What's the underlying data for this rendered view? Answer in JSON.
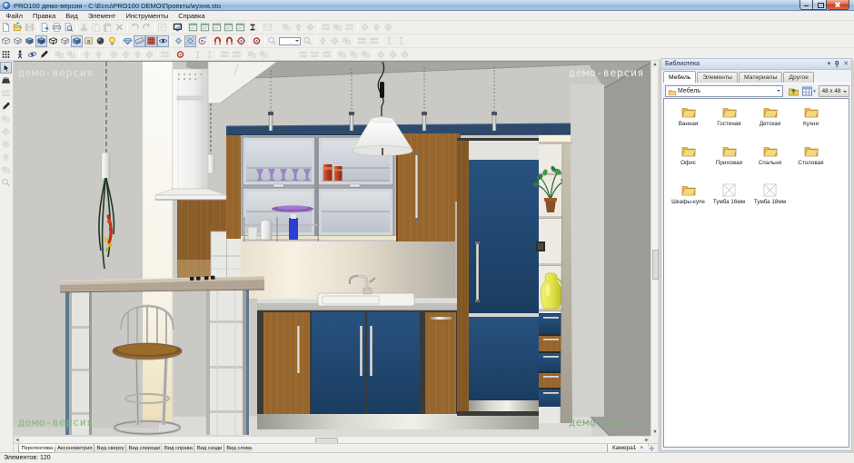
{
  "window": {
    "title": "PRO100 демо-версия - C:\\Ecru\\PRO100 DEMO\\Проекты\\кухня.sto",
    "controls": [
      {
        "name": "minimize"
      },
      {
        "name": "maximize"
      },
      {
        "name": "close"
      }
    ]
  },
  "menu": {
    "items": [
      "Файл",
      "Правка",
      "Вид",
      "Элемент",
      "Инструменты",
      "Справка"
    ]
  },
  "toolbars": {
    "row1": [
      {
        "name": "new-file",
        "icon": "page"
      },
      {
        "name": "open-file",
        "icon": "open"
      },
      {
        "name": "save-file",
        "icon": "save",
        "disabled": true
      },
      {
        "sep": true
      },
      {
        "name": "export",
        "icon": "export"
      },
      {
        "name": "print",
        "icon": "print"
      },
      {
        "name": "print-preview",
        "icon": "preview"
      },
      {
        "sep": true
      },
      {
        "name": "cut",
        "icon": "cut",
        "disabled": true
      },
      {
        "name": "copy",
        "icon": "copy",
        "disabled": true
      },
      {
        "name": "paste",
        "icon": "paste",
        "disabled": true
      },
      {
        "name": "delete",
        "icon": "del",
        "disabled": true
      },
      {
        "sep": true
      },
      {
        "name": "undo",
        "icon": "undo",
        "disabled": true
      },
      {
        "name": "redo",
        "icon": "redo",
        "disabled": true
      },
      {
        "sep": true
      },
      {
        "name": "properties",
        "icon": "props",
        "disabled": true
      },
      {
        "sep": true
      },
      {
        "name": "projection",
        "icon": "screen"
      },
      {
        "sep": true
      },
      {
        "name": "view-report",
        "icon": "win"
      },
      {
        "name": "view-pricelist",
        "icon": "win"
      },
      {
        "name": "view-cutlist",
        "icon": "win"
      },
      {
        "name": "view-elements",
        "icon": "win"
      },
      {
        "name": "view-materials",
        "icon": "win"
      },
      {
        "name": "price-calc",
        "icon": "sigma"
      },
      {
        "sep": true
      },
      {
        "name": "send-mail",
        "icon": "mail",
        "disabled": true
      },
      {
        "gap": 8
      },
      {
        "name": "arrange-1",
        "icon": "g1",
        "disabled": true
      },
      {
        "name": "arrange-2",
        "icon": "g2",
        "disabled": true
      },
      {
        "name": "arrange-3",
        "icon": "g3",
        "disabled": true
      },
      {
        "sep": true
      },
      {
        "name": "align-1",
        "icon": "g4",
        "disabled": true
      },
      {
        "name": "align-2",
        "icon": "g1",
        "disabled": true
      },
      {
        "name": "align-3",
        "icon": "g4",
        "disabled": true
      },
      {
        "sep": true
      },
      {
        "name": "space-1",
        "icon": "g3",
        "disabled": true
      },
      {
        "name": "space-2",
        "icon": "g2",
        "disabled": true
      },
      {
        "name": "space-3",
        "icon": "g3",
        "disabled": true
      }
    ],
    "row2": [
      {
        "name": "view-wireframe",
        "icon": "cube-wire"
      },
      {
        "name": "view-sketch",
        "icon": "cube-white"
      },
      {
        "name": "view-colors",
        "icon": "cube-blue"
      },
      {
        "name": "view-textures",
        "icon": "cube-tex",
        "pressed": true
      },
      {
        "name": "edges-all",
        "icon": "cube-edge"
      },
      {
        "name": "edges-white",
        "icon": "cube-white"
      },
      {
        "name": "edges-tex",
        "icon": "cube-blue",
        "pressed": true
      },
      {
        "name": "show-labels",
        "icon": "tex-a"
      },
      {
        "name": "antialias",
        "icon": "sphere"
      },
      {
        "name": "lighting",
        "icon": "bulb"
      },
      {
        "sep": true
      },
      {
        "name": "high-quality",
        "icon": "gem"
      },
      {
        "name": "show-dimensions",
        "icon": "ruler",
        "pressed": true
      },
      {
        "name": "show-grid",
        "icon": "grid-red",
        "pressed": true
      },
      {
        "name": "show-all",
        "icon": "eye",
        "pressed": true
      },
      {
        "sep": true
      },
      {
        "name": "snap-small",
        "icon": "diamond"
      },
      {
        "name": "snap-grid",
        "icon": "diamond-box",
        "pressed": true
      },
      {
        "name": "snap-rotate",
        "icon": "rotor"
      },
      {
        "sep": true
      },
      {
        "name": "magnet-1",
        "icon": "magnet"
      },
      {
        "name": "magnet-2",
        "icon": "magnet"
      },
      {
        "name": "magnet-3",
        "icon": "snap"
      },
      {
        "sep": true
      },
      {
        "name": "center-view",
        "icon": "target"
      },
      {
        "sep": true
      },
      {
        "name": "zoom-out",
        "icon": "mag",
        "disabled": true
      },
      {
        "combo": true,
        "name": "zoom-select"
      },
      {
        "name": "zoom-in",
        "icon": "mag",
        "disabled": true
      },
      {
        "sep": true
      },
      {
        "name": "move-1",
        "icon": "g2",
        "disabled": true
      },
      {
        "name": "move-2",
        "icon": "g3",
        "disabled": true
      },
      {
        "name": "move-3",
        "icon": "g1",
        "disabled": true
      },
      {
        "sep": true
      },
      {
        "name": "dim-1",
        "icon": "g4",
        "disabled": true
      },
      {
        "name": "dim-2",
        "icon": "g4",
        "disabled": true
      },
      {
        "sep": true
      },
      {
        "name": "text-1",
        "icon": "g5",
        "disabled": true
      },
      {
        "name": "text-2",
        "icon": "g5",
        "disabled": true
      }
    ],
    "row3": [
      {
        "name": "grid-snap",
        "icon": "dots"
      },
      {
        "gap": 3
      },
      {
        "name": "walk-mode",
        "icon": "man"
      },
      {
        "name": "orbit-mode",
        "icon": "orbit"
      },
      {
        "name": "draw-mode",
        "icon": "pen"
      },
      {
        "sep": true
      },
      {
        "name": "group",
        "icon": "g1",
        "disabled": true
      },
      {
        "name": "ungroup",
        "icon": "g1",
        "disabled": true
      },
      {
        "sep": true
      },
      {
        "name": "flip-h",
        "icon": "g2",
        "disabled": true
      },
      {
        "name": "flip-v",
        "icon": "g2",
        "disabled": true
      },
      {
        "sep": true
      },
      {
        "name": "rotate-left",
        "icon": "g3",
        "disabled": true
      },
      {
        "name": "move-el",
        "icon": "g3",
        "disabled": true
      },
      {
        "name": "lift-el",
        "icon": "g2",
        "disabled": true
      },
      {
        "name": "fit-el",
        "icon": "g3",
        "disabled": true
      },
      {
        "sep": true
      },
      {
        "name": "edit-shape",
        "icon": "g4",
        "disabled": true
      },
      {
        "sep": true
      },
      {
        "name": "center-element",
        "icon": "target"
      },
      {
        "gap": 6
      },
      {
        "name": "prev-el",
        "icon": "g5",
        "disabled": true
      },
      {
        "name": "next-el",
        "icon": "g5",
        "disabled": true
      },
      {
        "sep": true
      },
      {
        "name": "sum-1",
        "icon": "g4",
        "disabled": true
      },
      {
        "name": "sum-2",
        "icon": "g4",
        "disabled": true
      },
      {
        "sep": true
      },
      {
        "name": "rep-1",
        "icon": "g1",
        "disabled": true
      },
      {
        "name": "rep-2",
        "icon": "g1",
        "disabled": true
      },
      {
        "gap": 30
      },
      {
        "name": "lay-1",
        "icon": "g4",
        "disabled": true
      },
      {
        "name": "lay-2",
        "icon": "g4",
        "disabled": true
      },
      {
        "name": "lay-3",
        "icon": "g4",
        "disabled": true
      },
      {
        "sep": true
      },
      {
        "name": "dist-1",
        "icon": "g1",
        "disabled": true
      },
      {
        "name": "dist-2",
        "icon": "g1",
        "disabled": true
      },
      {
        "name": "dist-3",
        "icon": "g1",
        "disabled": true
      },
      {
        "sep": true
      },
      {
        "name": "rot-1",
        "icon": "g3",
        "disabled": true
      },
      {
        "name": "rot-2",
        "icon": "g3",
        "disabled": true
      },
      {
        "name": "rot-3",
        "icon": "g3",
        "disabled": true
      }
    ],
    "left": [
      {
        "name": "select-tool",
        "icon": "arrow",
        "pressed": true
      },
      {
        "name": "wall-tool",
        "icon": "comb"
      },
      {
        "name": "dimension-tool",
        "icon": "g4",
        "disabled": true
      },
      {
        "name": "pencil-tool",
        "icon": "pen"
      },
      {
        "name": "floor-tool",
        "icon": "g1",
        "disabled": true
      },
      {
        "name": "move-tool",
        "icon": "g3",
        "disabled": true
      },
      {
        "name": "rotate-tool",
        "icon": "g3",
        "disabled": true
      },
      {
        "name": "scale-tool",
        "icon": "g2",
        "disabled": true
      },
      {
        "name": "mirror-tool",
        "icon": "g1",
        "disabled": true
      },
      {
        "name": "zoom-tool",
        "icon": "mag",
        "disabled": true
      }
    ]
  },
  "viewport": {
    "watermark": "демо-версия"
  },
  "view_tabs": {
    "tabs": [
      {
        "label": "Перспектива",
        "active": true
      },
      {
        "label": "Аксонометрия"
      },
      {
        "label": "Вид сверху"
      },
      {
        "label": "Вид спереди"
      },
      {
        "label": "Вид справа"
      },
      {
        "label": "Вид сзади"
      },
      {
        "label": "Вид слева"
      }
    ],
    "camera_tab": "Камера1",
    "camera_close": "×"
  },
  "library": {
    "title": "Библиотека",
    "tabs": [
      {
        "label": "Мебель",
        "active": true
      },
      {
        "label": "Элементы"
      },
      {
        "label": "Материалы"
      },
      {
        "label": "Другое"
      }
    ],
    "path": "Мебель",
    "size_label": "48 x 48",
    "items": [
      {
        "label": "Ванная",
        "icon": "folder"
      },
      {
        "label": "Гостиная",
        "icon": "folder"
      },
      {
        "label": "Детская",
        "icon": "folder"
      },
      {
        "label": "Кухни",
        "icon": "folder"
      },
      {
        "label": "Офис",
        "icon": "folder"
      },
      {
        "label": "Прихожая",
        "icon": "folder"
      },
      {
        "label": "Спальня",
        "icon": "folder"
      },
      {
        "label": "Столовая",
        "icon": "folder"
      },
      {
        "label": "Шкафы-купе",
        "icon": "folder"
      },
      {
        "label": "Тумба 16мм",
        "icon": "empty"
      },
      {
        "label": "Тумба 18мм",
        "icon": "empty"
      }
    ]
  },
  "status": {
    "text": "Элементов: 120"
  }
}
